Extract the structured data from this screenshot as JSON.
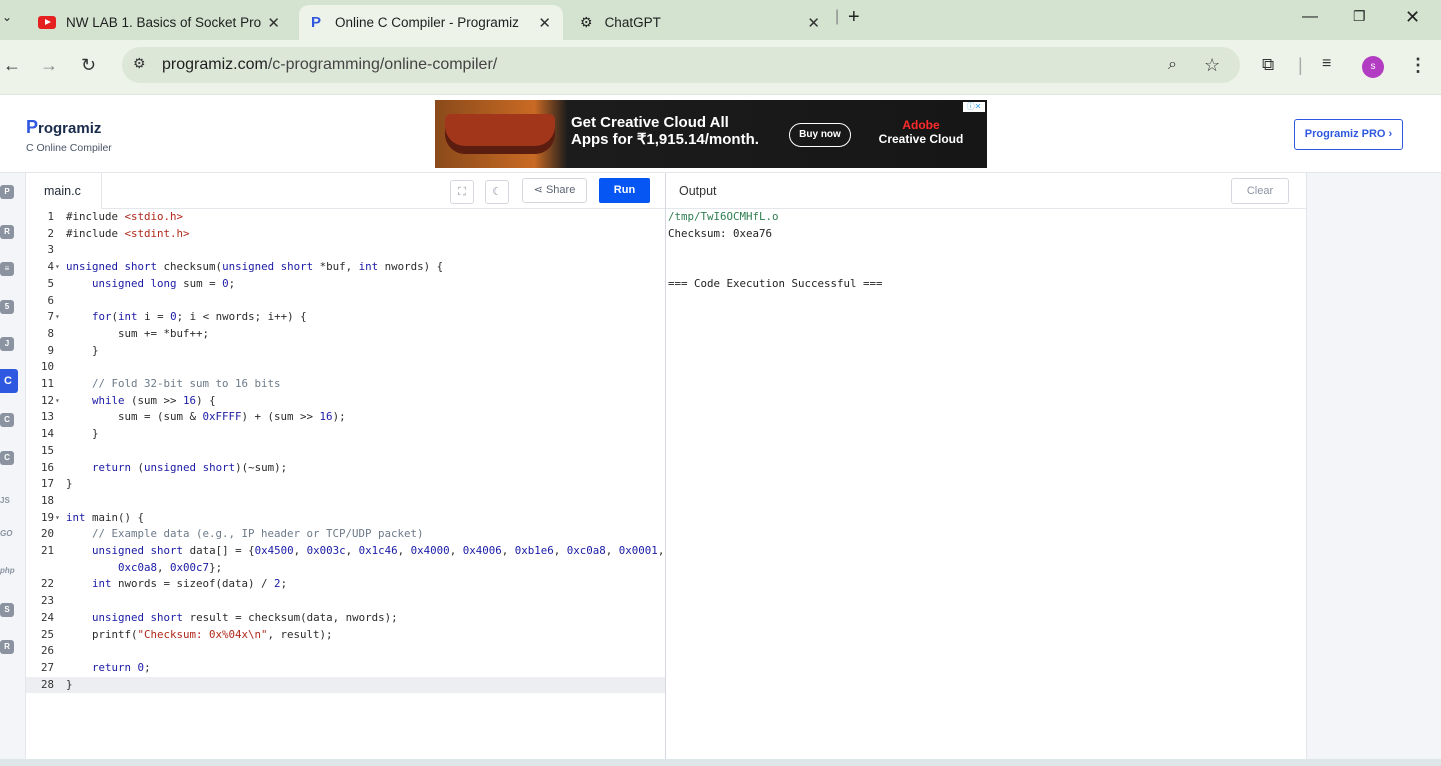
{
  "browser": {
    "tabs": [
      {
        "title": "NW LAB 1. Basics of Socket Pro",
        "icon": "youtube-icon"
      },
      {
        "title": "Online C Compiler - Programiz",
        "icon": "programiz-icon"
      },
      {
        "title": "ChatGPT",
        "icon": "chatgpt-icon"
      }
    ],
    "url_host": "programiz.com",
    "url_path": "/c-programming/online-compiler/",
    "profile_initial": "s"
  },
  "site": {
    "logo": "rogramiz",
    "logo_p": "P",
    "subtitle": "C Online Compiler",
    "pro_button": "Programiz PRO ›",
    "ad": {
      "headline1": "Get Creative Cloud All",
      "headline2": "Apps for ₹1,915.14/month.",
      "cta": "Buy now",
      "brand1": "Adobe",
      "brand2": "Creative Cloud"
    }
  },
  "editor": {
    "file_tab": "main.c",
    "share_label": "Share",
    "run_label": "Run",
    "lines": [
      {
        "n": "1",
        "fold": "",
        "code": "#include <stdio.h>"
      },
      {
        "n": "2",
        "fold": "",
        "code": "#include <stdint.h>"
      },
      {
        "n": "3",
        "fold": "",
        "code": ""
      },
      {
        "n": "4",
        "fold": "▾",
        "code": "unsigned short checksum(unsigned short *buf, int nwords) {"
      },
      {
        "n": "5",
        "fold": "",
        "code": "    unsigned long sum = 0;"
      },
      {
        "n": "6",
        "fold": "",
        "code": ""
      },
      {
        "n": "7",
        "fold": "▾",
        "code": "    for(int i = 0; i < nwords; i++) {"
      },
      {
        "n": "8",
        "fold": "",
        "code": "        sum += *buf++;"
      },
      {
        "n": "9",
        "fold": "",
        "code": "    }"
      },
      {
        "n": "10",
        "fold": "",
        "code": ""
      },
      {
        "n": "11",
        "fold": "",
        "code": "    // Fold 32-bit sum to 16 bits"
      },
      {
        "n": "12",
        "fold": "▾",
        "code": "    while (sum >> 16) {"
      },
      {
        "n": "13",
        "fold": "",
        "code": "        sum = (sum & 0xFFFF) + (sum >> 16);"
      },
      {
        "n": "14",
        "fold": "",
        "code": "    }"
      },
      {
        "n": "15",
        "fold": "",
        "code": ""
      },
      {
        "n": "16",
        "fold": "",
        "code": "    return (unsigned short)(~sum);"
      },
      {
        "n": "17",
        "fold": "",
        "code": "}"
      },
      {
        "n": "18",
        "fold": "",
        "code": ""
      },
      {
        "n": "19",
        "fold": "▾",
        "code": "int main() {"
      },
      {
        "n": "20",
        "fold": "",
        "code": "    // Example data (e.g., IP header or TCP/UDP packet)"
      },
      {
        "n": "21",
        "fold": "",
        "code": "    unsigned short data[] = {0x4500, 0x003c, 0x1c46, 0x4000, 0x4006, 0xb1e6, 0xc0a8, 0x0001,"
      },
      {
        "n": "",
        "fold": "",
        "code": "        0xc0a8, 0x00c7};"
      },
      {
        "n": "22",
        "fold": "",
        "code": "    int nwords = sizeof(data) / 2;"
      },
      {
        "n": "23",
        "fold": "",
        "code": ""
      },
      {
        "n": "24",
        "fold": "",
        "code": "    unsigned short result = checksum(data, nwords);"
      },
      {
        "n": "25",
        "fold": "",
        "code": "    printf(\"Checksum: 0x%04x\\n\", result);"
      },
      {
        "n": "26",
        "fold": "",
        "code": ""
      },
      {
        "n": "27",
        "fold": "",
        "code": "    return 0;"
      },
      {
        "n": "28",
        "fold": "",
        "code": "}"
      }
    ]
  },
  "output": {
    "title": "Output",
    "clear_label": "Clear",
    "lines": [
      "/tmp/TwI6OCMHfL.o",
      "Checksum: 0xea76",
      "",
      "",
      "=== Code Execution Successful ==="
    ]
  },
  "sidebar": {
    "languages": [
      "python",
      "r",
      "sql",
      "html",
      "java",
      "c",
      "cpp",
      "csharp",
      "js",
      "go",
      "php",
      "swift",
      "rust"
    ],
    "text_icons": {
      "js": "JS",
      "go": "GO",
      "php": "php"
    }
  }
}
